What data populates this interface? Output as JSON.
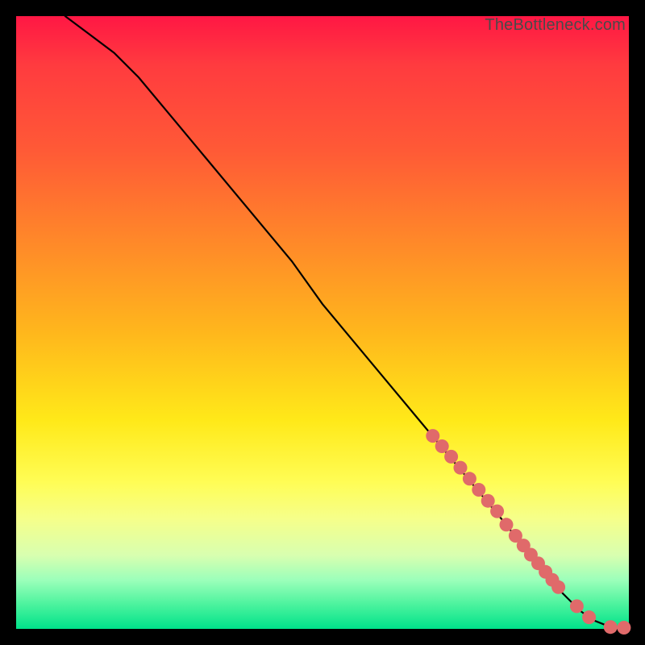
{
  "watermark": "TheBottleneck.com",
  "chart_data": {
    "type": "line",
    "title": "",
    "xlabel": "",
    "ylabel": "",
    "xlim": [
      0,
      100
    ],
    "ylim": [
      0,
      100
    ],
    "series": [
      {
        "name": "curve",
        "x": [
          8,
          12,
          16,
          20,
          25,
          30,
          35,
          40,
          45,
          50,
          55,
          60,
          65,
          70,
          75,
          80,
          83,
          86,
          88,
          90,
          92,
          94,
          96,
          98,
          100
        ],
        "y": [
          100,
          97,
          94,
          90,
          84,
          78,
          72,
          66,
          60,
          53,
          47,
          41,
          35,
          29,
          23,
          17,
          13,
          10,
          7,
          5,
          3,
          1.5,
          0.7,
          0.3,
          0.2
        ]
      }
    ],
    "markers": {
      "name": "highlight-points",
      "x": [
        68,
        69.5,
        71,
        72.5,
        74,
        75.5,
        77,
        78.5,
        80,
        81.5,
        82.8,
        84,
        85.2,
        86.4,
        87.5,
        88.5,
        91.5,
        93.5,
        97,
        99.2
      ],
      "y": [
        31.5,
        29.8,
        28.1,
        26.3,
        24.5,
        22.7,
        20.9,
        19.2,
        17,
        15.2,
        13.6,
        12.1,
        10.7,
        9.3,
        8.0,
        6.8,
        3.7,
        1.9,
        0.3,
        0.2
      ]
    },
    "gradient_stops": [
      {
        "pos": 0.0,
        "color": "#ff1744"
      },
      {
        "pos": 0.08,
        "color": "#ff3b3f"
      },
      {
        "pos": 0.22,
        "color": "#ff5a36"
      },
      {
        "pos": 0.38,
        "color": "#ff8c28"
      },
      {
        "pos": 0.52,
        "color": "#ffb81c"
      },
      {
        "pos": 0.66,
        "color": "#ffe919"
      },
      {
        "pos": 0.76,
        "color": "#fffd55"
      },
      {
        "pos": 0.82,
        "color": "#f6ff8a"
      },
      {
        "pos": 0.88,
        "color": "#d8ffb0"
      },
      {
        "pos": 0.92,
        "color": "#9cffba"
      },
      {
        "pos": 0.96,
        "color": "#4cf39e"
      },
      {
        "pos": 1.0,
        "color": "#00e28a"
      }
    ]
  }
}
